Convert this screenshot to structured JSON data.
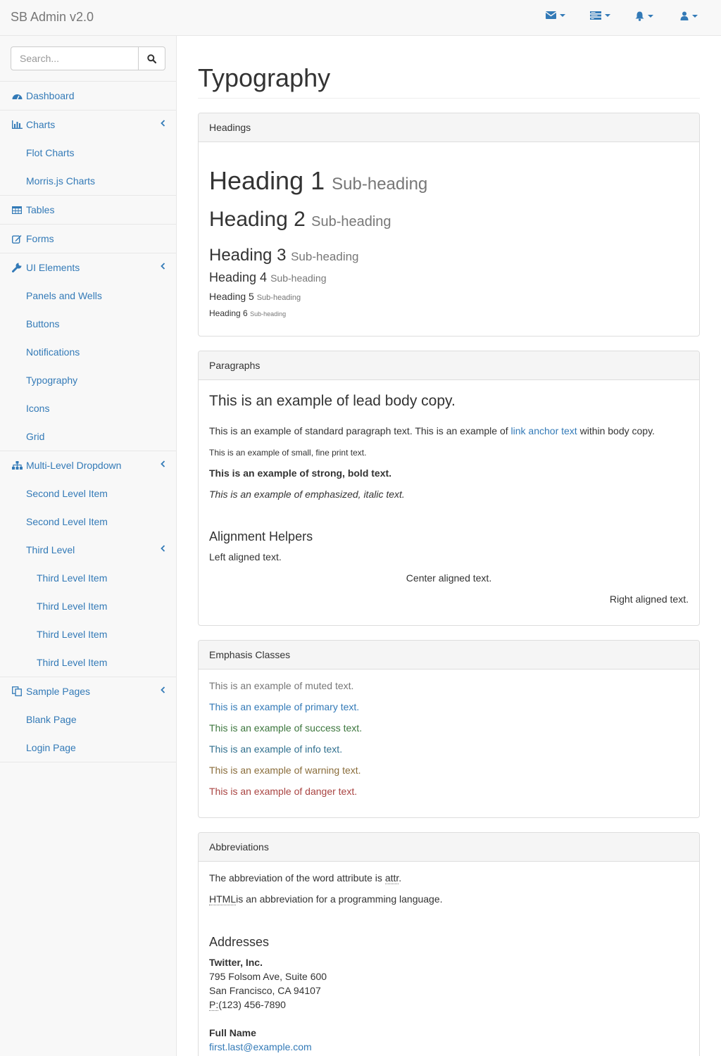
{
  "navbar": {
    "brand": "SB Admin v2.0",
    "icons": [
      "envelope-icon",
      "tasks-icon",
      "bell-icon",
      "user-icon"
    ]
  },
  "sidebar": {
    "search_placeholder": "Search...",
    "items": {
      "dashboard": "Dashboard",
      "charts": "Charts",
      "flot_charts": "Flot Charts",
      "morris_charts": "Morris.js Charts",
      "tables": "Tables",
      "forms": "Forms",
      "ui_elements": "UI Elements",
      "panels_wells": "Panels and Wells",
      "buttons": "Buttons",
      "notifications": "Notifications",
      "typography": "Typography",
      "icons": "Icons",
      "grid": "Grid",
      "multi_level": "Multi-Level Dropdown",
      "second_level_1": "Second Level Item",
      "second_level_2": "Second Level Item",
      "third_level": "Third Level",
      "third_level_item_1": "Third Level Item",
      "third_level_item_2": "Third Level Item",
      "third_level_item_3": "Third Level Item",
      "third_level_item_4": "Third Level Item",
      "sample_pages": "Sample Pages",
      "blank_page": "Blank Page",
      "login_page": "Login Page"
    }
  },
  "page": {
    "title": "Typography",
    "headings_panel": {
      "title": "Headings",
      "h1": "Heading 1",
      "h2": "Heading 2",
      "h3": "Heading 3",
      "h4": "Heading 4",
      "h5": "Heading 5",
      "h6": "Heading 6",
      "sub": "Sub-heading"
    },
    "paragraphs_panel": {
      "title": "Paragraphs",
      "lead": "This is an example of lead body copy.",
      "standard_1": "This is an example of standard paragraph text. This is an example of ",
      "link": "link anchor text",
      "standard_2": " within body copy.",
      "small": "This is an example of small, fine print text.",
      "strong": "This is an example of strong, bold text.",
      "em": "This is an example of emphasized, italic text.",
      "alignment_heading": "Alignment Helpers",
      "left": "Left aligned text.",
      "center": "Center aligned text.",
      "right": "Right aligned text."
    },
    "emphasis_panel": {
      "title": "Emphasis Classes",
      "muted": "This is an example of muted text.",
      "primary": "This is an example of primary text.",
      "success": "This is an example of success text.",
      "info": "This is an example of info text.",
      "warning": "This is an example of warning text.",
      "danger": "This is an example of danger text."
    },
    "abbreviations_panel": {
      "title": "Abbreviations",
      "abbr_line_prefix": "The abbreviation of the word attribute is ",
      "abbr_attr": "attr",
      "abbr_line_suffix": ".",
      "html_abbr": "HTML",
      "html_line": "is an abbreviation for a programming language.",
      "addresses_heading": "Addresses",
      "company": "Twitter, Inc.",
      "street": "795 Folsom Ave, Suite 600",
      "city": "San Francisco, CA 94107",
      "phone_label": "P:",
      "phone": "(123) 456-7890",
      "full_name": "Full Name",
      "email": "first.last@example.com"
    }
  },
  "colors": {
    "link": "#337ab7",
    "muted": "#777777",
    "success": "#3c763d",
    "info": "#31708f",
    "warning": "#8a6d3b",
    "danger": "#a94442"
  }
}
